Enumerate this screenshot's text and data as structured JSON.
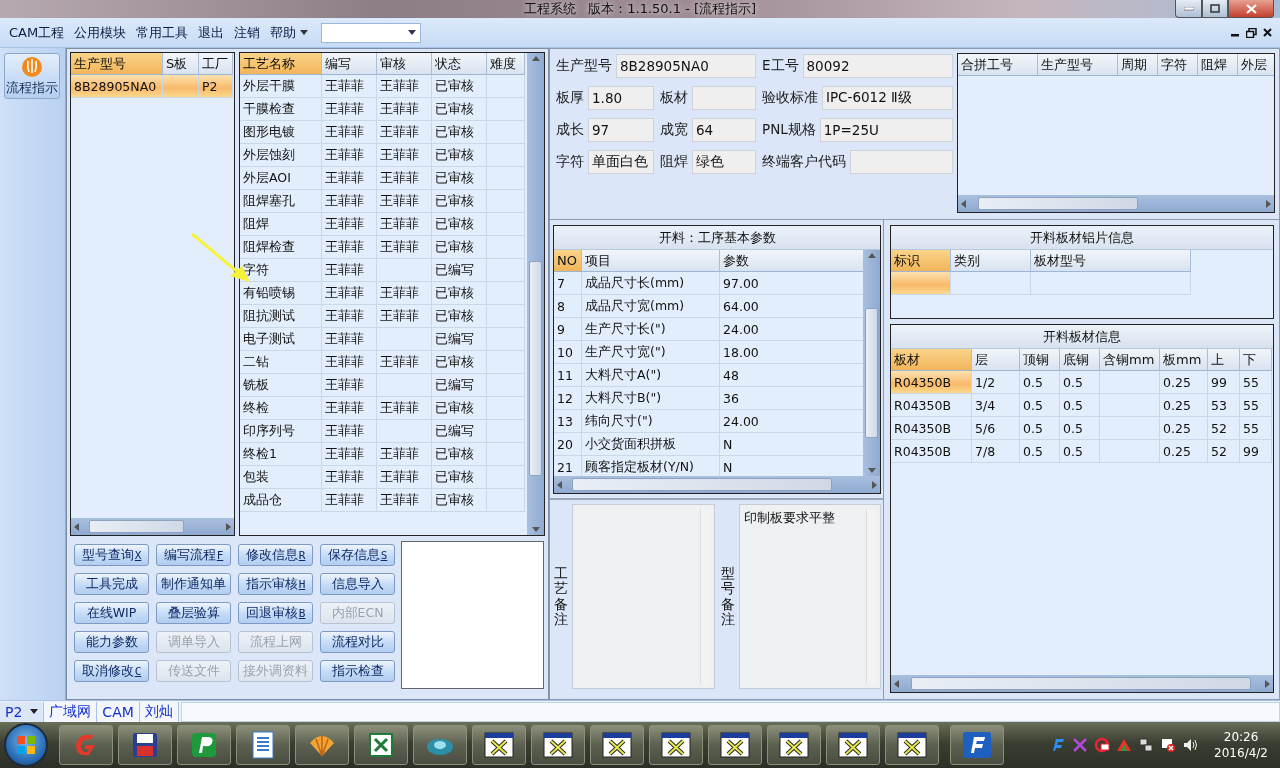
{
  "window": {
    "title": "工程系统   版本：1.1.50.1 - [流程指示]"
  },
  "menu": [
    {
      "label": "CAM工程",
      "kind": "item"
    },
    {
      "label": "公用模块",
      "kind": "item"
    },
    {
      "label": "常用工具",
      "kind": "item"
    },
    {
      "label": "退出",
      "kind": "item"
    },
    {
      "label": "注销",
      "kind": "item"
    },
    {
      "label": "帮助",
      "kind": "dropdown"
    }
  ],
  "sidebar": {
    "items": [
      {
        "label": "流程指示",
        "selected": true
      }
    ]
  },
  "model_table": {
    "columns": [
      {
        "label": "生产型号",
        "selected": true
      },
      {
        "label": "S板",
        "selected": false
      },
      {
        "label": "工厂",
        "selected": false
      }
    ],
    "rows": [
      {
        "cells": [
          "8B28905NA0",
          "",
          "P2"
        ],
        "selected": true
      }
    ]
  },
  "process_table": {
    "columns": [
      {
        "label": "工艺名称",
        "selected": true
      },
      {
        "label": "编写",
        "selected": false
      },
      {
        "label": "审核",
        "selected": false
      },
      {
        "label": "状态",
        "selected": false
      },
      {
        "label": "难度",
        "selected": false
      }
    ],
    "rows": [
      {
        "cells": [
          "外层干膜",
          "王菲菲",
          "王菲菲",
          "已审核"
        ]
      },
      {
        "cells": [
          "干膜检查",
          "王菲菲",
          "王菲菲",
          "已审核"
        ]
      },
      {
        "cells": [
          "图形电镀",
          "王菲菲",
          "王菲菲",
          "已审核"
        ]
      },
      {
        "cells": [
          "外层蚀刻",
          "王菲菲",
          "王菲菲",
          "已审核"
        ]
      },
      {
        "cells": [
          "外层AOI",
          "王菲菲",
          "王菲菲",
          "已审核"
        ]
      },
      {
        "cells": [
          "阻焊塞孔",
          "王菲菲",
          "王菲菲",
          "已审核"
        ]
      },
      {
        "cells": [
          "阻焊",
          "王菲菲",
          "王菲菲",
          "已审核"
        ]
      },
      {
        "cells": [
          "阻焊检查",
          "王菲菲",
          "王菲菲",
          "已审核"
        ]
      },
      {
        "cells": [
          "字符",
          "王菲菲",
          "",
          "已编写"
        ]
      },
      {
        "cells": [
          "有铅喷锡",
          "王菲菲",
          "王菲菲",
          "已审核"
        ]
      },
      {
        "cells": [
          "阻抗测试",
          "王菲菲",
          "王菲菲",
          "已审核"
        ]
      },
      {
        "cells": [
          "电子测试",
          "王菲菲",
          "",
          "已编写"
        ]
      },
      {
        "cells": [
          "二钻",
          "王菲菲",
          "王菲菲",
          "已审核"
        ]
      },
      {
        "cells": [
          "铣板",
          "王菲菲",
          "",
          "已编写"
        ]
      },
      {
        "cells": [
          "终检",
          "王菲菲",
          "王菲菲",
          "已审核"
        ]
      },
      {
        "cells": [
          "印序列号",
          "王菲菲",
          "",
          "已编写"
        ]
      },
      {
        "cells": [
          "终检1",
          "王菲菲",
          "王菲菲",
          "已审核"
        ]
      },
      {
        "cells": [
          "包装",
          "王菲菲",
          "王菲菲",
          "已审核"
        ]
      },
      {
        "cells": [
          "成品仓",
          "王菲菲",
          "王菲菲",
          "已审核"
        ]
      }
    ]
  },
  "buttons": [
    {
      "label": "型号查询",
      "hotkey": "X",
      "disabled": false
    },
    {
      "label": "编写流程",
      "hotkey": "F",
      "disabled": false
    },
    {
      "label": "修改信息",
      "hotkey": "R",
      "disabled": false
    },
    {
      "label": "保存信息",
      "hotkey": "S",
      "disabled": false
    },
    {
      "label": "工具完成",
      "disabled": false
    },
    {
      "label": "制作通知单",
      "disabled": false
    },
    {
      "label": "指示审核",
      "hotkey": "H",
      "disabled": false
    },
    {
      "label": "信息导入",
      "disabled": false
    },
    {
      "label": "在线WIP",
      "disabled": false
    },
    {
      "label": "叠层验算",
      "disabled": false
    },
    {
      "label": "回退审核",
      "hotkey": "B",
      "disabled": false
    },
    {
      "label": "内部ECN",
      "disabled": true
    },
    {
      "label": "能力参数",
      "disabled": false
    },
    {
      "label": "调单导入",
      "disabled": true
    },
    {
      "label": "流程上网",
      "disabled": true
    },
    {
      "label": "流程对比",
      "disabled": false
    },
    {
      "label": "取消修改",
      "hotkey": "C",
      "disabled": false
    },
    {
      "label": "传送文件",
      "disabled": true
    },
    {
      "label": "接外调资料",
      "disabled": true
    },
    {
      "label": "指示检查",
      "disabled": false
    }
  ],
  "info_form": {
    "fields": [
      {
        "label": "生产型号",
        "value": "8B28905NA0"
      },
      {
        "label": "E工号",
        "value": "80092"
      },
      {
        "label": "板厚",
        "value": "1.80"
      },
      {
        "label": "板材"
      },
      {
        "label": "验收标准",
        "value": "IPC-6012 Ⅱ级"
      },
      {
        "label": "成长",
        "value": "97"
      },
      {
        "label": "成宽",
        "value": "64"
      },
      {
        "label": "PNL规格",
        "value": "1P=25U"
      },
      {
        "label": "字符",
        "value": "单面白色"
      },
      {
        "label": "阻焊",
        "value": "绿色"
      },
      {
        "label": "终端客户代码"
      }
    ]
  },
  "merge_table": {
    "columns": [
      {
        "label": "合拼工号"
      },
      {
        "label": "生产型号"
      },
      {
        "label": "周期"
      },
      {
        "label": "字符"
      },
      {
        "label": "阻焊"
      },
      {
        "label": "外层"
      }
    ]
  },
  "params_table": {
    "title": "开料：工序基本参数",
    "columns": [
      {
        "label": "NO",
        "selected": true
      },
      {
        "label": "项目",
        "selected": false
      },
      {
        "label": "参数",
        "selected": false
      }
    ],
    "rows": [
      {
        "cells": [
          "7",
          "成品尺寸长(mm)",
          "97.00"
        ]
      },
      {
        "cells": [
          "8",
          "成品尺寸宽(mm)",
          "64.00"
        ]
      },
      {
        "cells": [
          "9",
          "生产尺寸长(\")",
          "24.00"
        ]
      },
      {
        "cells": [
          "10",
          "生产尺寸宽(\")",
          "18.00"
        ]
      },
      {
        "cells": [
          "11",
          "大料尺寸A(\")",
          "48"
        ]
      },
      {
        "cells": [
          "12",
          "大料尺寸B(\")",
          "36"
        ]
      },
      {
        "cells": [
          "13",
          "纬向尺寸(\")",
          "24.00"
        ]
      },
      {
        "cells": [
          "20",
          "小交货面积拼板",
          "N"
        ]
      },
      {
        "cells": [
          "21",
          "顾客指定板材(Y/N)",
          "N"
        ]
      }
    ]
  },
  "remarks": [
    {
      "label": "工艺备注"
    },
    {
      "label": "型号备注",
      "value": "印制板要求平整"
    }
  ],
  "foil_table": {
    "title": "开料板材铝片信息",
    "columns": [
      {
        "label": "标识",
        "selected": true
      },
      {
        "label": "类别",
        "selected": false
      },
      {
        "label": "板材型号",
        "selected": false
      }
    ],
    "rows": [
      {
        "selected": true
      }
    ]
  },
  "material_table": {
    "title": "开料板材信息",
    "columns": [
      {
        "label": "板材",
        "selected": true
      },
      {
        "label": "层",
        "selected": false
      },
      {
        "label": "顶铜",
        "selected": false
      },
      {
        "label": "底铜",
        "selected": false
      },
      {
        "label": "含铜mm",
        "selected": false
      },
      {
        "label": "板mm",
        "selected": false
      },
      {
        "label": "上",
        "selected": false
      },
      {
        "label": "下",
        "selected": false
      }
    ],
    "rows": [
      {
        "cells": [
          "R04350B",
          "1/2",
          "0.5",
          "0.5",
          "",
          "0.25",
          "99",
          "55"
        ],
        "selected": true
      },
      {
        "cells": [
          "R04350B",
          "3/4",
          "0.5",
          "0.5",
          "",
          "0.25",
          "53",
          "55"
        ],
        "selected": false
      },
      {
        "cells": [
          "R04350B",
          "5/6",
          "0.5",
          "0.5",
          "",
          "0.25",
          "52",
          "55"
        ],
        "selected": false
      },
      {
        "cells": [
          "R04350B",
          "7/8",
          "0.5",
          "0.5",
          "",
          "0.25",
          "52",
          "99"
        ],
        "selected": false
      }
    ]
  },
  "status_bar": [
    {
      "label": "P2",
      "kind": "dropdown"
    },
    {
      "label": "广域网",
      "kind": "text"
    },
    {
      "label": "CAM",
      "kind": "text"
    },
    {
      "label": "刘灿",
      "kind": "text"
    }
  ],
  "taskbar": {
    "clock": {
      "time": "20:26",
      "date": "2016/4/2"
    }
  }
}
